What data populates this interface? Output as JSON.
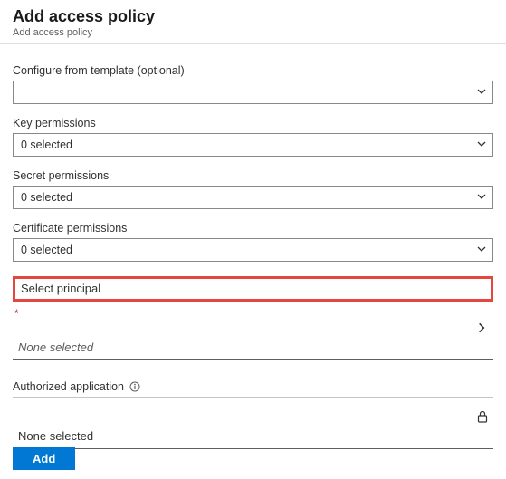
{
  "header": {
    "title": "Add access policy",
    "subtitle": "Add access policy"
  },
  "fields": {
    "template": {
      "label": "Configure from template (optional)",
      "value": ""
    },
    "key": {
      "label": "Key permissions",
      "value": "0 selected"
    },
    "secret": {
      "label": "Secret permissions",
      "value": "0 selected"
    },
    "certificate": {
      "label": "Certificate permissions",
      "value": "0 selected"
    }
  },
  "principal": {
    "section_label": "Select principal",
    "value": "None selected"
  },
  "authorized_app": {
    "label": "Authorized application",
    "value": "None selected"
  },
  "footer": {
    "add": "Add"
  }
}
